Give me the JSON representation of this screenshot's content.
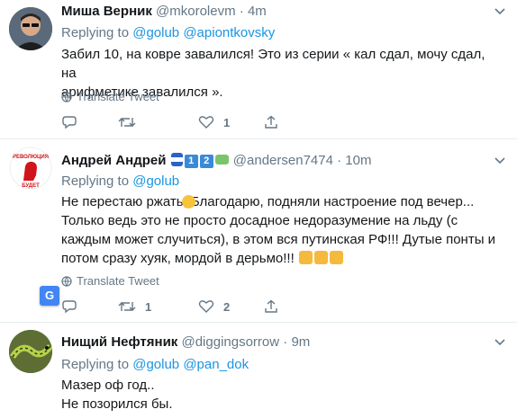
{
  "tweets": [
    {
      "name": "Миша Верник",
      "handle": "@mkorolevm",
      "sep": "·",
      "time": "4m",
      "replying_prefix": "Replying to",
      "replying_to": [
        "@golub",
        "@apiontkovsky"
      ],
      "text_lines": [
        "Забил 10, на ковре завалился! Это из серии « кал сдал, мочу сдал, на",
        "арифметике завалился »."
      ],
      "translate": "Translate Tweet",
      "reply_count": "",
      "retweet_count": "",
      "like_count": "1"
    },
    {
      "name": "Андрей Андрей",
      "handle": "@andersen7474",
      "sep": "·",
      "time": "10m",
      "badges": [
        "1",
        "2"
      ],
      "replying_prefix": "Replying to",
      "replying_to": [
        "@golub"
      ],
      "text_lines": [
        "Не перестаю ржать, Благодарю, подняли настроение под вечер...",
        "Только ведь это не просто досадное недоразумение на льду (с",
        "каждым может случиться), в этом вся путинская РФ!!! Дутые понты и",
        "потом сразу хуяк, мордой в дерьмо!!!"
      ],
      "translate": "Translate Tweet",
      "reply_count": "",
      "retweet_count": "1",
      "like_count": "2"
    },
    {
      "name": "Нищий Нефтяник",
      "handle": "@diggingsorrow",
      "sep": "·",
      "time": "9m",
      "replying_prefix": "Replying to",
      "replying_to": [
        "@golub",
        "@pan_dok"
      ],
      "text_lines": [
        "Мазер оф год..",
        "Не позорился бы."
      ]
    }
  ],
  "avatar2_text": [
    "РЕВОЛЮЦИЯ",
    "БУДЕТ"
  ],
  "gt_icon_text": "G",
  "colors": {
    "link": "#1b95e0",
    "muted": "#657786",
    "text": "#14171a",
    "divider": "#e6ecf0"
  }
}
